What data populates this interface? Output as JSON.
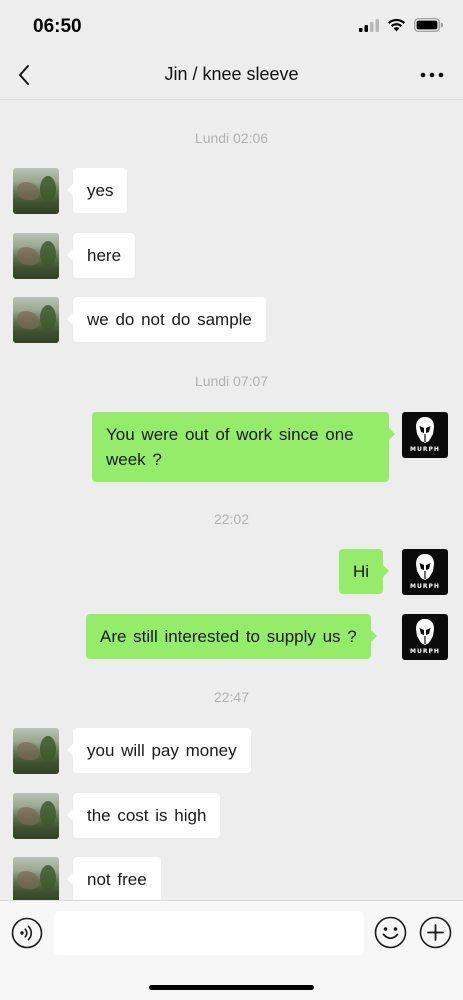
{
  "status_bar": {
    "time": "06:50",
    "icons": [
      "cellular-signal-icon",
      "wifi-icon",
      "battery-icon"
    ]
  },
  "nav": {
    "title": "Jin / knee sleeve",
    "back_icon": "chevron-left-icon",
    "more_icon": "ellipsis-icon"
  },
  "contact_brand": "MURPH",
  "timestamps": [
    "Lundi 02:06",
    "Lundi 07:07",
    "22:02",
    "22:47"
  ],
  "messages": [
    {
      "side": "in",
      "text": "yes"
    },
    {
      "side": "in",
      "text": "here"
    },
    {
      "side": "in",
      "text": "we  do not  do  sample"
    },
    {
      "side": "out",
      "text": "You were out of work since one week ?"
    },
    {
      "side": "out",
      "text": "Hi"
    },
    {
      "side": "out",
      "text": "Are still interested to supply us ?"
    },
    {
      "side": "in",
      "text": "you  will  pay money"
    },
    {
      "side": "in",
      "text": "the  cost  is  high"
    },
    {
      "side": "in",
      "text": "not  free"
    }
  ],
  "input_bar": {
    "placeholder": "",
    "left_icon": "voice-icon",
    "right_icons": [
      "emoji-icon",
      "plus-icon"
    ]
  },
  "colors": {
    "background": "#ededed",
    "outgoing_bubble": "#95ec69",
    "incoming_bubble": "#ffffff",
    "timestamp_text": "#b2b2b2"
  }
}
